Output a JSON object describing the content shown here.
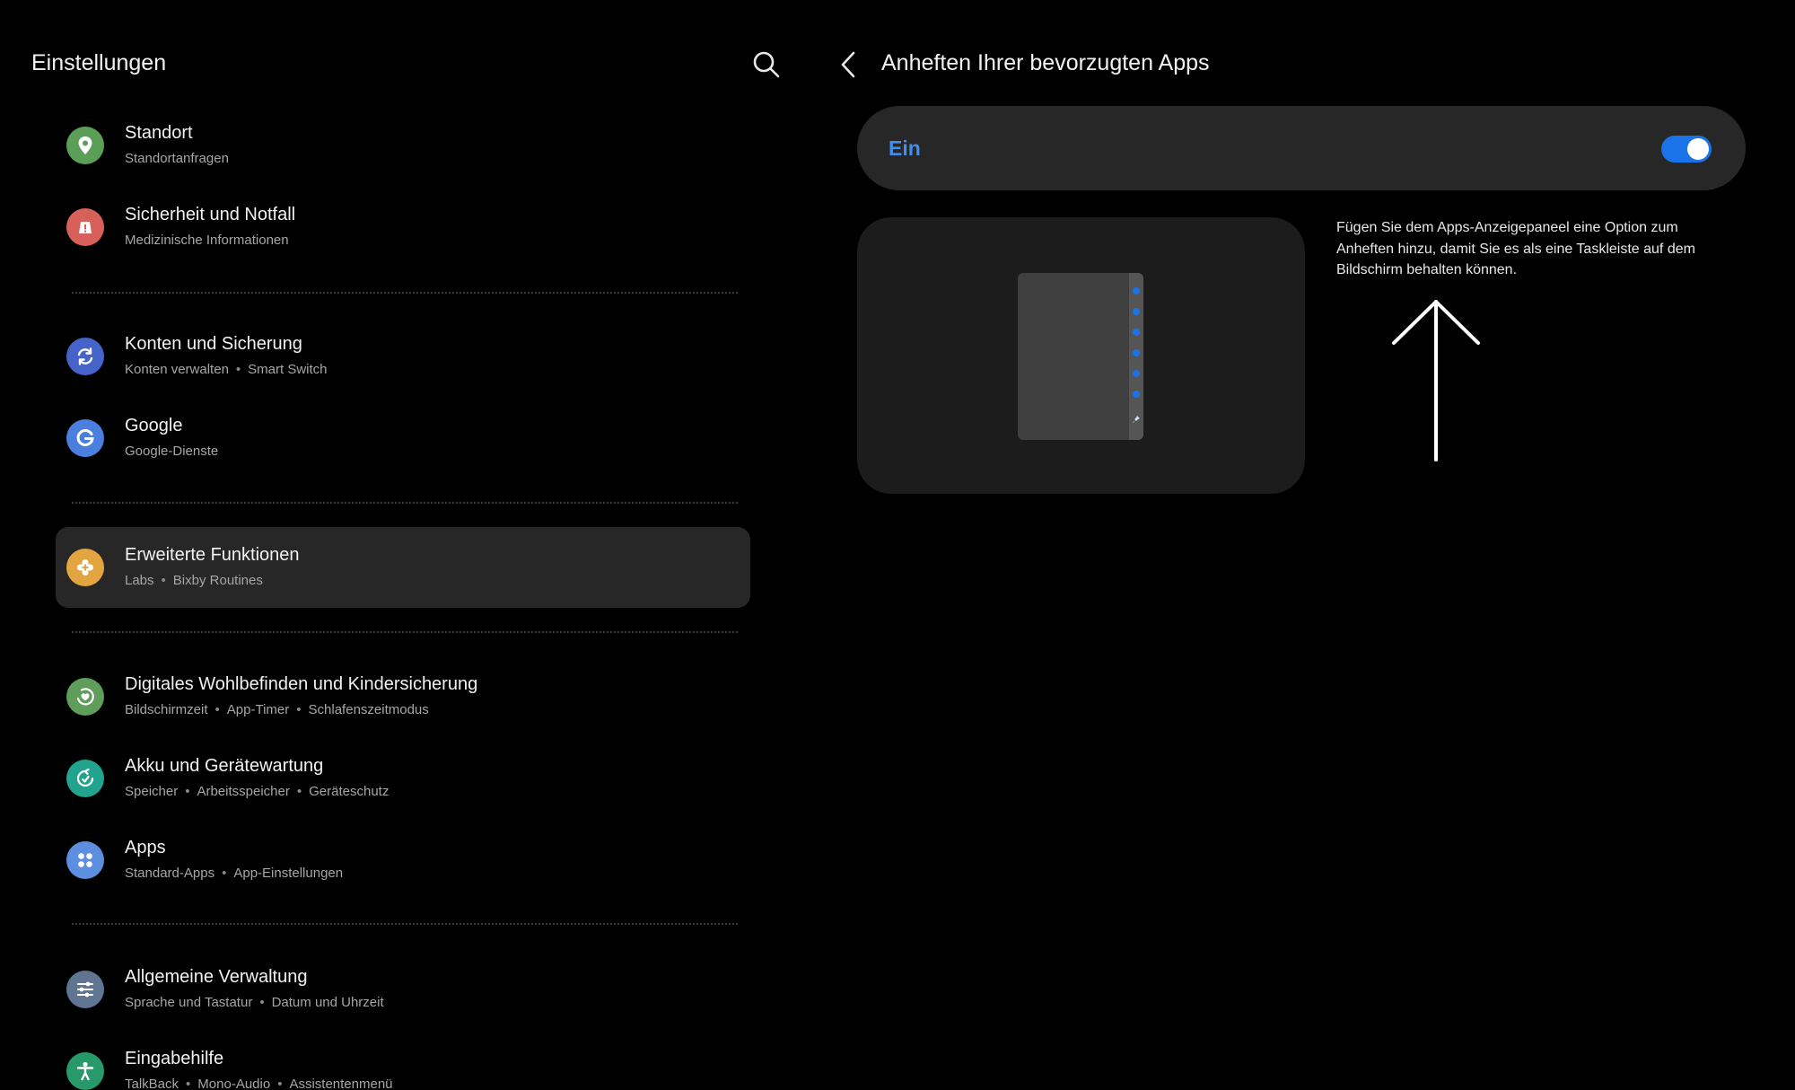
{
  "left": {
    "title": "Einstellungen",
    "search_icon": "search-icon",
    "items": [
      {
        "name": "standort",
        "title": "Standort",
        "subs": [
          "Standortanfragen"
        ],
        "icon": "location-pin-icon",
        "color": "#5a9e57"
      },
      {
        "name": "sicherheit-notfall",
        "title": "Sicherheit und Notfall",
        "subs": [
          "Medizinische Informationen"
        ],
        "icon": "emergency-alert-icon",
        "color": "#d8605a"
      },
      {
        "name": "konten-sicherung",
        "title": "Konten und Sicherung",
        "subs": [
          "Konten verwalten",
          "Smart Switch"
        ],
        "icon": "sync-icon",
        "color": "#4563c9"
      },
      {
        "name": "google",
        "title": "Google",
        "subs": [
          "Google-Dienste"
        ],
        "icon": "google-g-icon",
        "color": "#4a7fe0"
      },
      {
        "name": "erweiterte-funktionen",
        "title": "Erweiterte Funktionen",
        "subs": [
          "Labs",
          "Bixby Routines"
        ],
        "icon": "puzzle-plus-icon",
        "color": "#e3a540",
        "selected": true
      },
      {
        "name": "digitales-wohlbefinden",
        "title": "Digitales Wohlbefinden und Kindersicherung",
        "subs": [
          "Bildschirmzeit",
          "App-Timer",
          "Schlafenszeitmodus"
        ],
        "icon": "heart-circle-icon",
        "color": "#5e9d5a"
      },
      {
        "name": "akku-geraetewartung",
        "title": "Akku und Gerätewartung",
        "subs": [
          "Speicher",
          "Arbeitsspeicher",
          "Geräteschutz"
        ],
        "icon": "device-care-icon",
        "color": "#21a38e"
      },
      {
        "name": "apps",
        "title": "Apps",
        "subs": [
          "Standard-Apps",
          "App-Einstellungen"
        ],
        "icon": "apps-grid-icon",
        "color": "#5d8ee0"
      },
      {
        "name": "allgemeine-verwaltung",
        "title": "Allgemeine Verwaltung",
        "subs": [
          "Sprache und Tastatur",
          "Datum und Uhrzeit"
        ],
        "icon": "sliders-icon",
        "color": "#5f7591"
      },
      {
        "name": "eingabehilfe",
        "title": "Eingabehilfe",
        "subs": [
          "TalkBack",
          "Mono-Audio",
          "Assistentenmenü"
        ],
        "icon": "accessibility-person-icon",
        "color": "#28996a"
      }
    ]
  },
  "right": {
    "title": "Anheften Ihrer bevorzugten Apps",
    "toggle_label": "Ein",
    "toggle_on": true,
    "description": "Fügen Sie dem Apps-Anzeigepaneel eine Option zum Anheften hinzu, damit Sie es als eine Taskleiste auf dem Bildschirm behalten können.",
    "accent_color": "#1a73e8"
  }
}
